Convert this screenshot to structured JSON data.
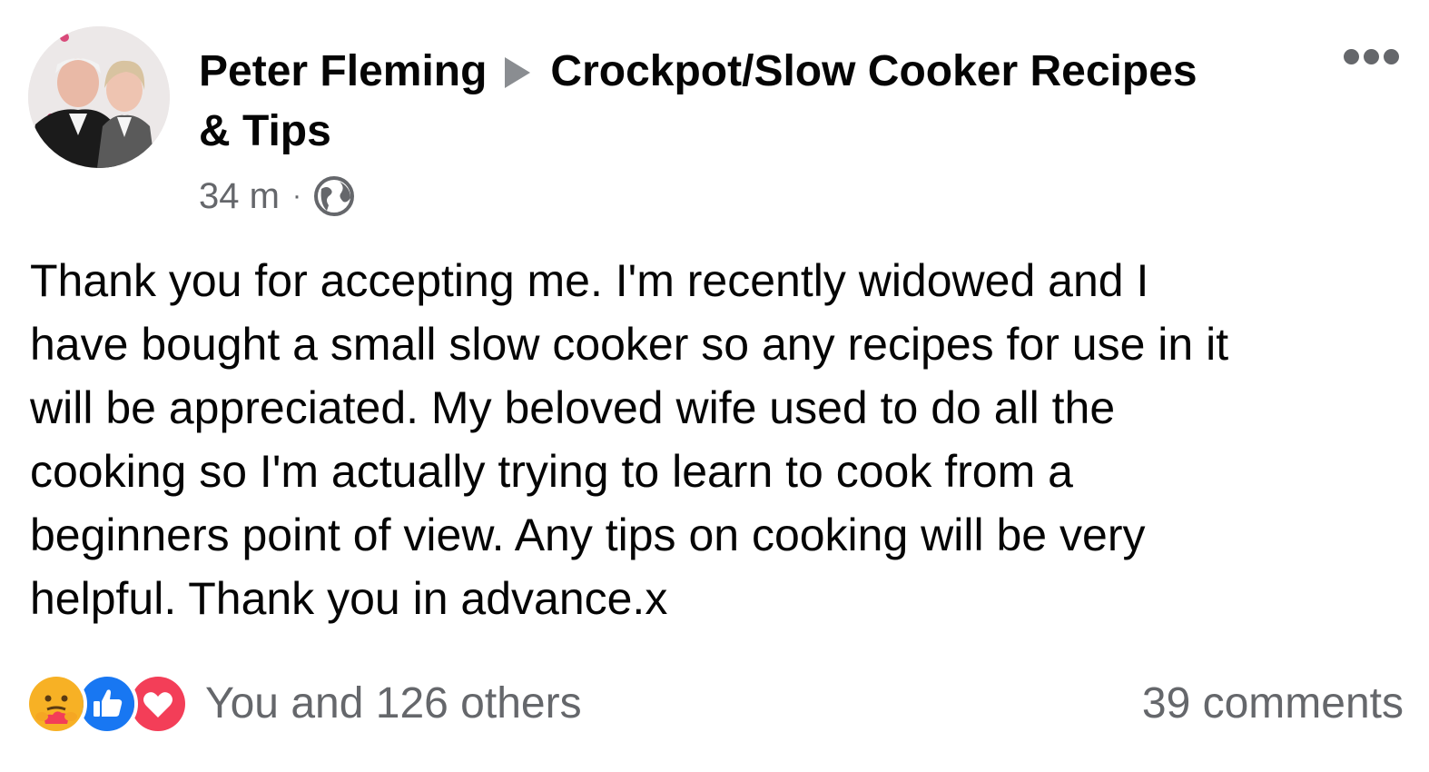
{
  "post": {
    "author": "Peter Fleming",
    "group": "Crockpot/Slow Cooker Recipes & Tips",
    "timestamp": "34 m",
    "separator": "·",
    "privacy_icon": "globe-icon",
    "more_icon": "more-options-icon",
    "text": "Thank you for accepting me. I'm recently widowed and I\nhave bought a small slow cooker so any recipes for use in it\nwill be appreciated. My beloved wife used to do all the\ncooking so I'm actually trying to learn to cook from a\nbeginners point of view.  Any tips on cooking will be very\nhelpful. Thank you in advance.x"
  },
  "reactions": {
    "icons": [
      "care-reaction-icon",
      "like-reaction-icon",
      "love-reaction-icon"
    ],
    "summary": "You and 126 others",
    "comments": "39 comments"
  },
  "colors": {
    "primary_text": "#050505",
    "secondary_text": "#65676b",
    "like_blue": "#1877f2",
    "love_red": "#f33e58",
    "care_yellow": "#f7b125"
  }
}
